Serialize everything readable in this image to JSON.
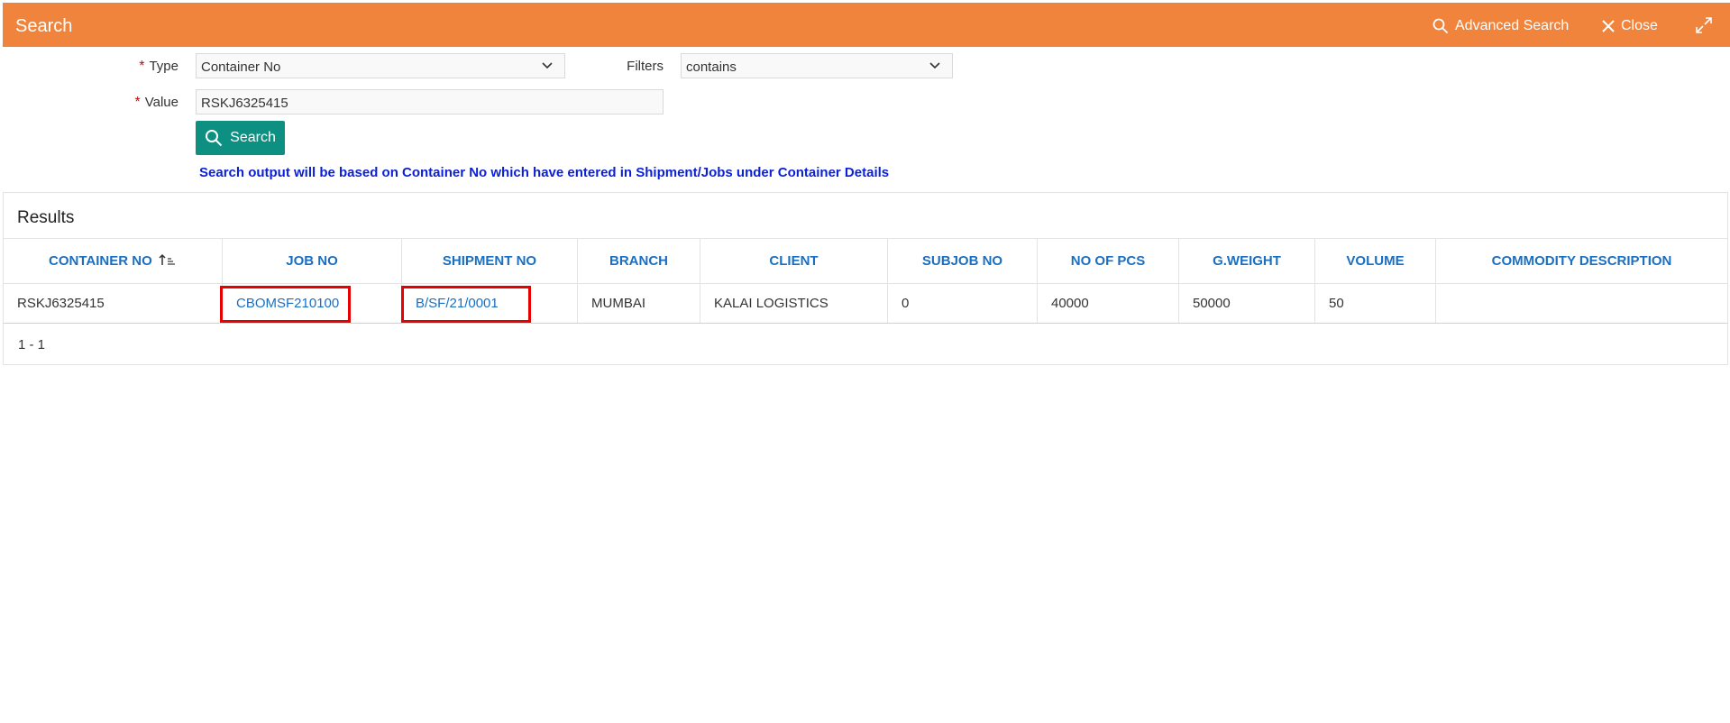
{
  "header": {
    "title": "Search",
    "advanced_search": "Advanced Search",
    "close": "Close"
  },
  "form": {
    "type_label": "Type",
    "type_value": "Container No",
    "filters_label": "Filters",
    "filters_value": "contains",
    "value_label": "Value",
    "value_value": "RSKJ6325415",
    "required_mark": "*",
    "search_button": "Search",
    "note": "Search output will be based on Container No which have entered in Shipment/Jobs under Container Details"
  },
  "results": {
    "title": "Results",
    "columns": [
      "CONTAINER NO",
      "JOB NO",
      "SHIPMENT NO",
      "BRANCH",
      "CLIENT",
      "SUBJOB NO",
      "NO OF PCS",
      "G.WEIGHT",
      "VOLUME",
      "COMMODITY DESCRIPTION"
    ],
    "row": {
      "container_no": "RSKJ6325415",
      "job_no": "CBOMSF210100",
      "shipment_no": "B/SF/21/0001",
      "branch": "MUMBAI",
      "client": "KALAI LOGISTICS",
      "subjob_no": "0",
      "no_of_pcs": "40000",
      "g_weight": "50000",
      "volume": "50",
      "commodity_description": ""
    },
    "pagination": "1 - 1"
  },
  "icons": {
    "advanced_search": "search-icon",
    "close": "close-icon",
    "expand": "expand-icon",
    "sort": "sort-ascending-icon",
    "dropdown": "chevron-down-icon"
  },
  "colors": {
    "header_bg": "#f0843c",
    "button_bg": "#0d8f81",
    "link": "#1a6fc1",
    "note": "#0a1fd6",
    "required": "#e00000",
    "highlight": "#e60000"
  }
}
